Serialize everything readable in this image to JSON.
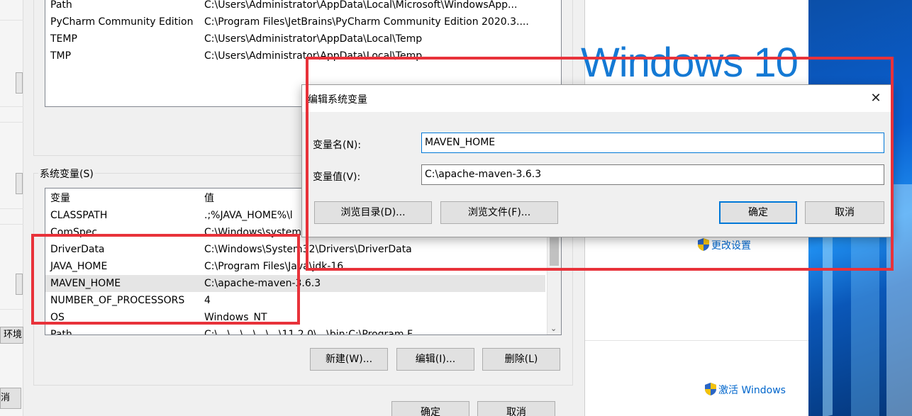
{
  "left_strip": {
    "env_label": "环境",
    "cancel_label": "消"
  },
  "user_vars": {
    "rows": [
      {
        "name": "Path",
        "value": "C:\\Users\\Administrator\\AppData\\Local\\Microsoft\\WindowsApp..."
      },
      {
        "name": "PyCharm Community Edition",
        "value": "C:\\Program Files\\JetBrains\\PyCharm Community Edition 2020.3...."
      },
      {
        "name": "TEMP",
        "value": "C:\\Users\\Administrator\\AppData\\Local\\Temp"
      },
      {
        "name": "TMP",
        "value": "C:\\Users\\Administrator\\AppData\\Local\\Temp"
      }
    ]
  },
  "system_vars": {
    "group_label": "系统变量(S)",
    "col_var": "变量",
    "col_val": "值",
    "rows": [
      {
        "name": "CLASSPATH",
        "value": ".;%JAVA_HOME%\\l"
      },
      {
        "name": "ComSpec",
        "value": "C:\\Windows\\system"
      },
      {
        "name": "DriverData",
        "value": "C:\\Windows\\System32\\Drivers\\DriverData"
      },
      {
        "name": "JAVA_HOME",
        "value": "C:\\Program Files\\Java\\jdk-16"
      },
      {
        "name": "MAVEN_HOME",
        "value": "C:\\apache-maven-3.6.3"
      },
      {
        "name": "NUMBER_OF_PROCESSORS",
        "value": "4"
      },
      {
        "name": "OS",
        "value": "Windows_NT"
      },
      {
        "name": "Path",
        "value": "C:\\...\\...\\...\\...\\...\\11.2.0\\...\\bin;C:\\Program F..."
      }
    ],
    "new_button": "新建(W)...",
    "edit_button": "编辑(I)...",
    "delete_button": "删除(L)"
  },
  "env_footer": {
    "ok_button": "确定",
    "cancel_button": "取消"
  },
  "system_panel": {
    "windows_logo_text": "Windows 10",
    "change_settings_link": "更改设置",
    "activate_windows_link": "激活 Windows"
  },
  "edit_dialog": {
    "title": "编辑系统变量",
    "close_glyph": "✕",
    "name_label": "变量名(N):",
    "name_value": "MAVEN_HOME",
    "value_label": "变量值(V):",
    "value_value": "C:\\apache-maven-3.6.3",
    "browse_dir_button": "浏览目录(D)...",
    "browse_file_button": "浏览文件(F)...",
    "ok_button": "确定",
    "cancel_button": "取消"
  },
  "colors": {
    "annotation_red": "#e8323a",
    "accent_blue": "#0078d7",
    "link_blue": "#0066cc"
  }
}
